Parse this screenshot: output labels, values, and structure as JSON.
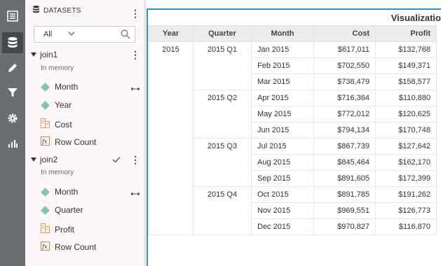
{
  "rail": {
    "items": [
      {
        "icon": "list-icon"
      },
      {
        "icon": "database-icon",
        "active": true
      },
      {
        "icon": "pencil-icon"
      },
      {
        "icon": "filter-icon"
      },
      {
        "icon": "gear-icon"
      },
      {
        "icon": "bar-chart-icon"
      }
    ]
  },
  "panel": {
    "title": "DATASETS",
    "filter": {
      "value": "All"
    },
    "datasets": [
      {
        "name": "join1",
        "sub": "In memory",
        "fields": [
          {
            "label": "Month",
            "type": "dimension",
            "linked": true
          },
          {
            "label": "Year",
            "type": "dimension"
          },
          {
            "label": "Cost",
            "type": "measure"
          },
          {
            "label": "Row Count",
            "type": "calc"
          }
        ]
      },
      {
        "name": "join2",
        "sub": "In memory",
        "checked": true,
        "fields": [
          {
            "label": "Month",
            "type": "dimension",
            "linked": true
          },
          {
            "label": "Quarter",
            "type": "dimension"
          },
          {
            "label": "Profit",
            "type": "measure"
          },
          {
            "label": "Row Count",
            "type": "calc"
          }
        ]
      }
    ]
  },
  "viz": {
    "title": "Visualizatio",
    "headers": [
      "Year",
      "Quarter",
      "Month",
      "Cost",
      "Profit"
    ],
    "year": "2015",
    "quarters": [
      {
        "label": "2015 Q1",
        "rows": [
          {
            "month": "Jan 2015",
            "cost": "$617,011",
            "profit": "$132,768"
          },
          {
            "month": "Feb 2015",
            "cost": "$702,550",
            "profit": "$149,371"
          },
          {
            "month": "Mar 2015",
            "cost": "$738,479",
            "profit": "$158,577"
          }
        ]
      },
      {
        "label": "2015 Q2",
        "rows": [
          {
            "month": "Apr 2015",
            "cost": "$716,364",
            "profit": "$110,880"
          },
          {
            "month": "May 2015",
            "cost": "$772,012",
            "profit": "$120,625"
          },
          {
            "month": "Jun 2015",
            "cost": "$794,134",
            "profit": "$170,748"
          }
        ]
      },
      {
        "label": "2015 Q3",
        "rows": [
          {
            "month": "Jul 2015",
            "cost": "$867,739",
            "profit": "$127,642"
          },
          {
            "month": "Aug 2015",
            "cost": "$845,464",
            "profit": "$162,170"
          },
          {
            "month": "Sep 2015",
            "cost": "$891,605",
            "profit": "$172,399"
          }
        ]
      },
      {
        "label": "2015 Q4",
        "rows": [
          {
            "month": "Oct 2015",
            "cost": "$891,785",
            "profit": "$191,262"
          },
          {
            "month": "Nov 2015",
            "cost": "$969,551",
            "profit": "$126,773"
          },
          {
            "month": "Dec 2015",
            "cost": "$970,827",
            "profit": "$116,870"
          }
        ]
      }
    ]
  }
}
